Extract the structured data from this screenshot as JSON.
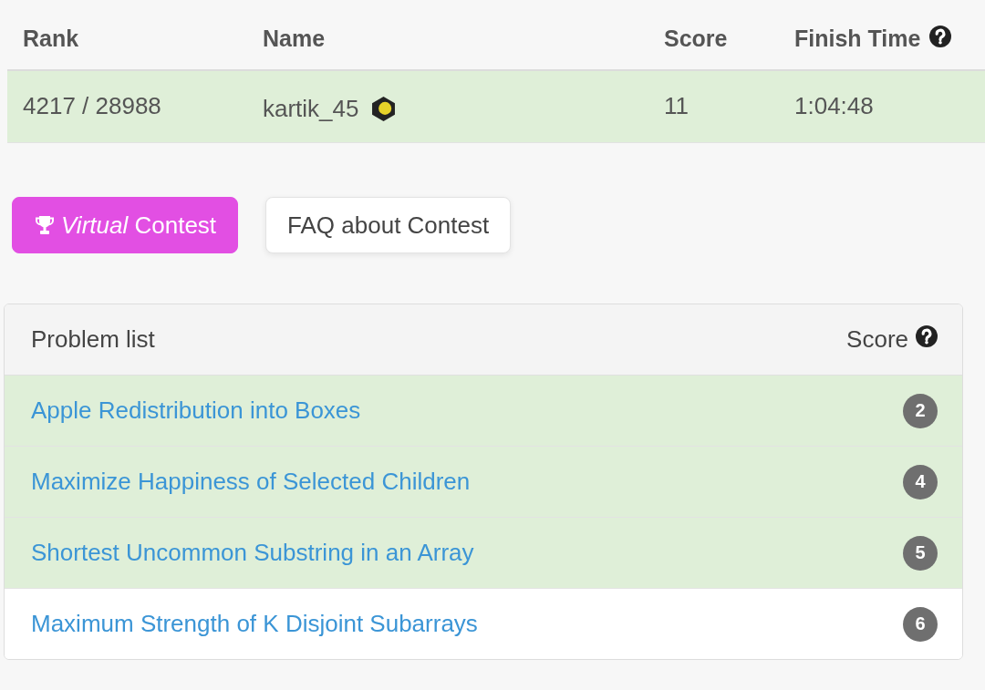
{
  "ranking": {
    "columns": [
      {
        "label": "Rank",
        "help": false
      },
      {
        "label": "Name",
        "help": false
      },
      {
        "label": "Score",
        "help": false
      },
      {
        "label": "Finish Time",
        "help": true
      }
    ],
    "rows": [
      {
        "rank": "4217 / 28988",
        "name": "kartik_45",
        "score": "11",
        "finish_time": "1:04:48",
        "highlighted": true
      }
    ]
  },
  "buttons": [
    {
      "label": "*Virtual* Contest",
      "kind": "primary"
    },
    {
      "label": "FAQ about Contest",
      "kind": "default"
    }
  ],
  "problem_list": {
    "title": "Problem list",
    "score_label": "Score",
    "score_help": true,
    "rows": [
      {
        "title": "Apple Redistribution into Boxes",
        "score": "2",
        "solved": true
      },
      {
        "title": "Maximize Happiness of Selected Children",
        "score": "4",
        "solved": true
      },
      {
        "title": "Shortest Uncommon Substring in an Array",
        "score": "5",
        "solved": true
      },
      {
        "title": "Maximum Strength of K Disjoint Subarrays",
        "score": "6",
        "solved": false
      }
    ]
  }
}
